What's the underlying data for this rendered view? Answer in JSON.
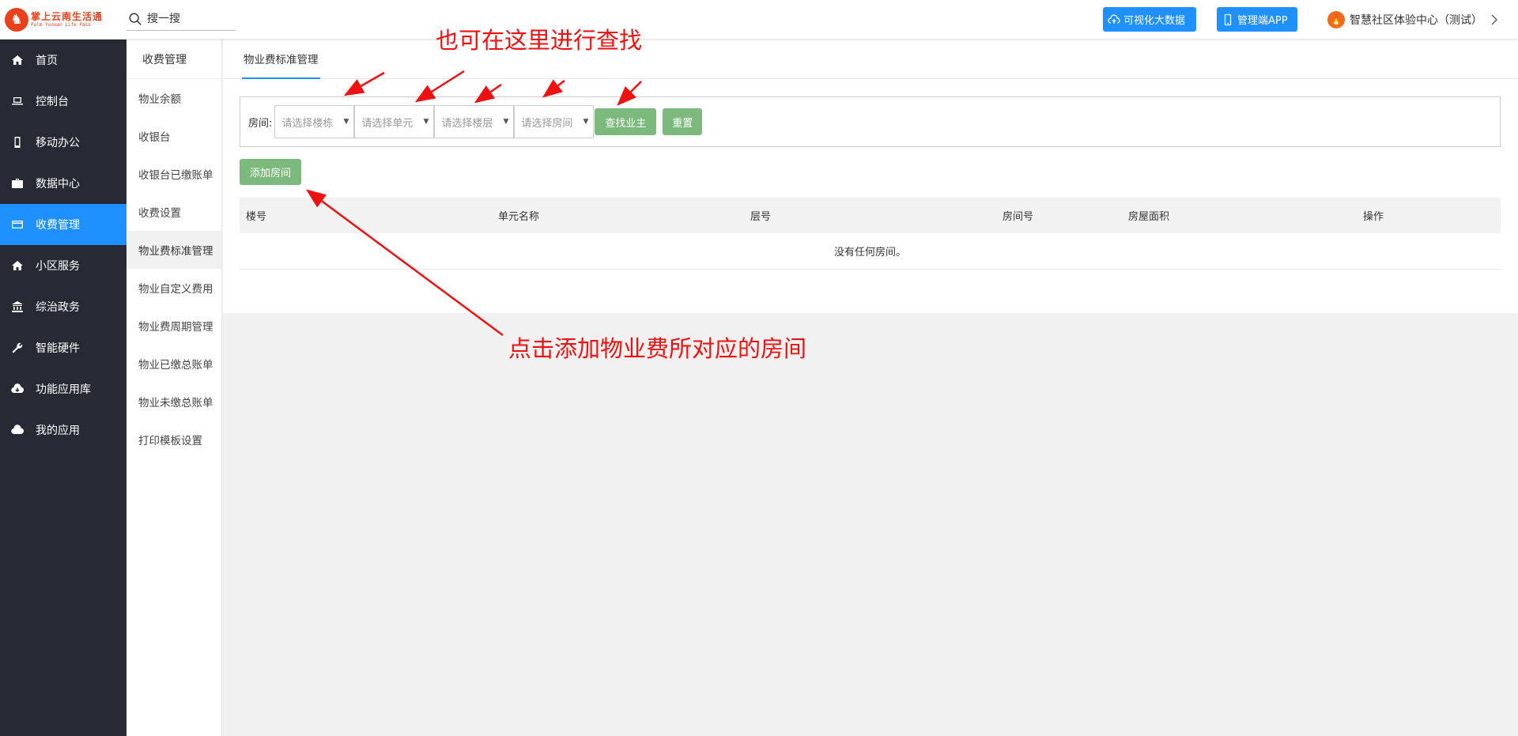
{
  "header": {
    "logo_cn": "掌上云南生活通",
    "logo_en": "Palm Yunnan Life Pass",
    "search_placeholder": "搜一搜",
    "btn_bigdata": "可视化大数据",
    "btn_app": "管理端APP",
    "center_name": "智慧社区体验中心（测试）",
    "colors": {
      "primary": "#1e90ff",
      "logo": "#e8411d"
    }
  },
  "sidebar": {
    "items": [
      {
        "label": "首页",
        "icon": "home-icon"
      },
      {
        "label": "控制台",
        "icon": "laptop-icon"
      },
      {
        "label": "移动办公",
        "icon": "mobile-icon"
      },
      {
        "label": "数据中心",
        "icon": "briefcase-icon"
      },
      {
        "label": "收费管理",
        "icon": "credit-card-icon",
        "active": true
      },
      {
        "label": "小区服务",
        "icon": "home-icon"
      },
      {
        "label": "综治政务",
        "icon": "bank-icon"
      },
      {
        "label": "智能硬件",
        "icon": "wrench-icon"
      },
      {
        "label": "功能应用库",
        "icon": "cloud-download-icon"
      },
      {
        "label": "我的应用",
        "icon": "cloud-icon"
      }
    ]
  },
  "subnav": {
    "title": "收费管理",
    "items": [
      {
        "label": "物业余额"
      },
      {
        "label": "收银台"
      },
      {
        "label": "收银台已缴账单"
      },
      {
        "label": "收费设置"
      },
      {
        "label": "物业费标准管理",
        "active": true
      },
      {
        "label": "物业自定义费用"
      },
      {
        "label": "物业费周期管理"
      },
      {
        "label": "物业已缴总账单"
      },
      {
        "label": "物业未缴总账单"
      },
      {
        "label": "打印模板设置"
      }
    ]
  },
  "main": {
    "tab": "物业费标准管理",
    "filter": {
      "label": "房间:",
      "selects": [
        "请选择楼栋",
        "请选择单元",
        "请选择楼层",
        "请选择房间"
      ],
      "find_btn": "查找业主",
      "reset_btn": "重置"
    },
    "add_btn": "添加房间",
    "table": {
      "headers": [
        "楼号",
        "单元名称",
        "层号",
        "房间号",
        "房屋面积",
        "操作"
      ],
      "empty_text": "没有任何房间。"
    },
    "colors": {
      "green_btn": "#7cb97c"
    }
  },
  "annotations": {
    "top": "也可在这里进行查找",
    "bottom": "点击添加物业费所对应的房间",
    "color": "#ee1111"
  }
}
